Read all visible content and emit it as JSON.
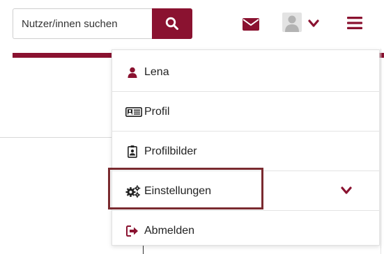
{
  "search": {
    "placeholder": "Nutzer/innen suchen",
    "icon": "search-icon"
  },
  "header": {
    "mail_icon": "envelope-icon",
    "avatar_icon": "user-avatar-icon",
    "menu_icon": "hamburger-icon"
  },
  "colors": {
    "accent": "#8a1230",
    "highlight_border": "#7a2a2f"
  },
  "user_menu": {
    "items": [
      {
        "label": "Lena",
        "icon": "user-icon"
      },
      {
        "label": "Profil",
        "icon": "id-card-icon"
      },
      {
        "label": "Profilbilder",
        "icon": "portrait-icon"
      },
      {
        "label": "Einstellungen",
        "icon": "gears-icon",
        "highlighted": true,
        "has_submenu": true
      },
      {
        "label": "Abmelden",
        "icon": "sign-out-icon"
      }
    ]
  }
}
